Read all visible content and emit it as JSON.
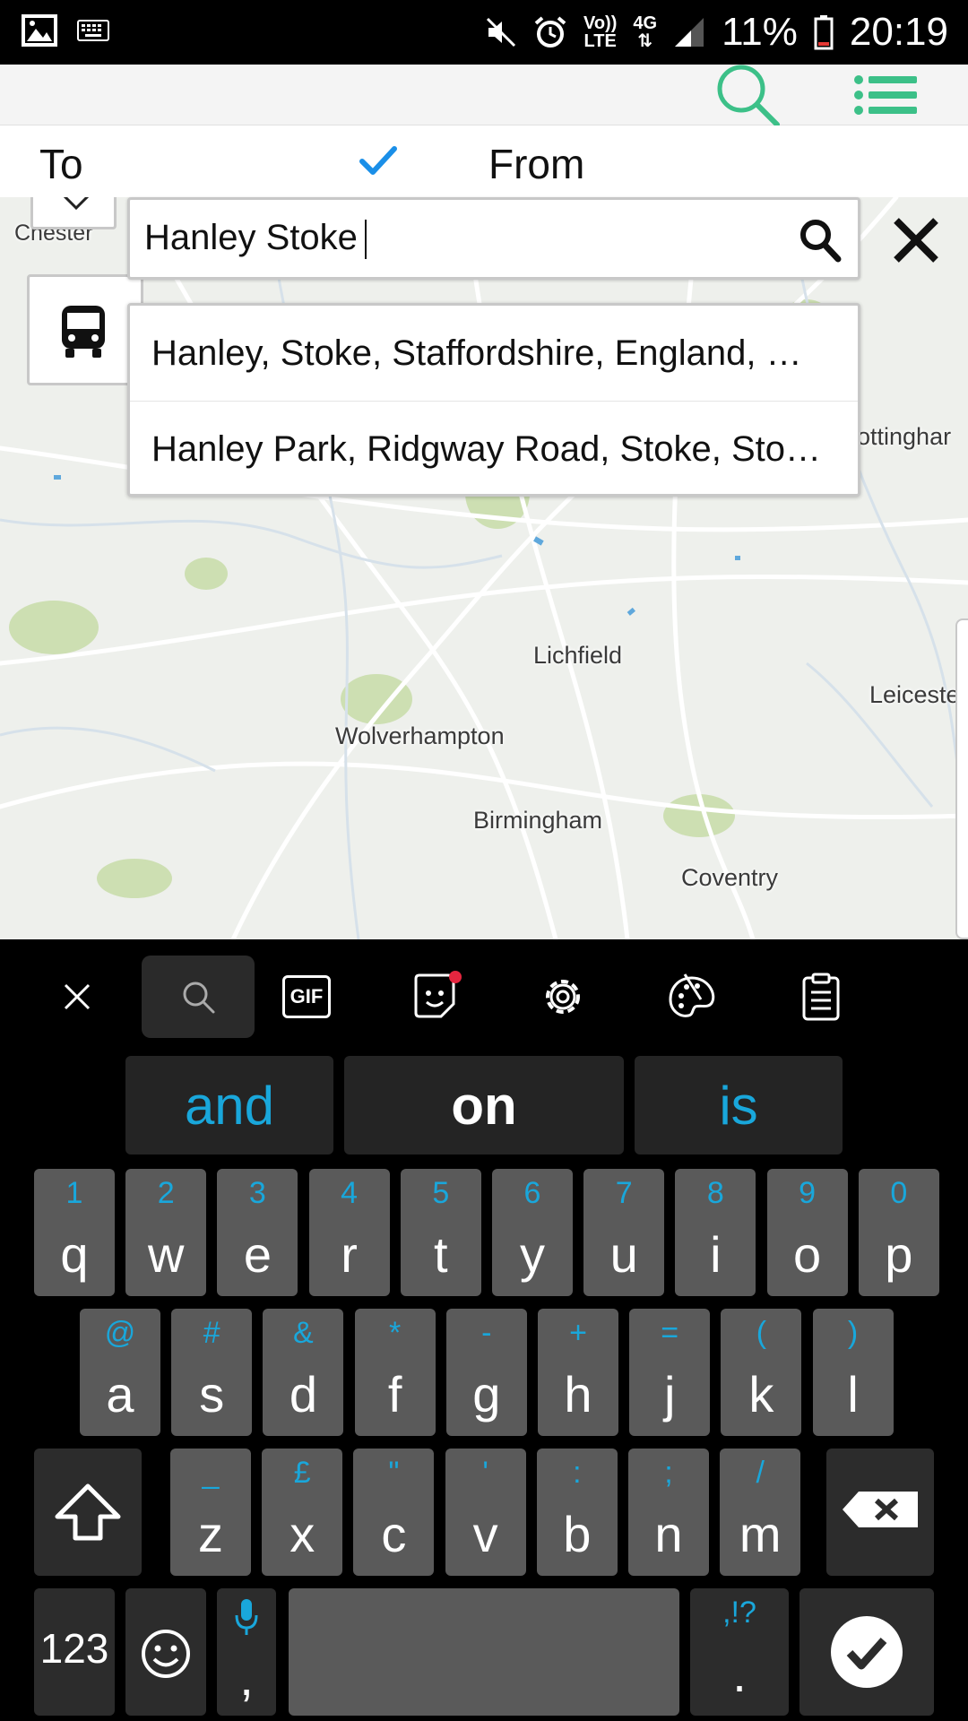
{
  "status_bar": {
    "volte_top": "Vo))",
    "volte_bottom": "LTE",
    "network": "4G",
    "battery": "11%",
    "time": "20:19"
  },
  "app_bar": {
    "icons": [
      "search-icon",
      "list-menu-icon"
    ],
    "accent": "#3cc088"
  },
  "direction": {
    "to_label": "To",
    "from_label": "From",
    "check_color": "#1a8fe8"
  },
  "search": {
    "value": "Hanley Stoke",
    "suggestions": [
      "Hanley, Stoke, Staffordshire, England, …",
      "Hanley Park, Ridgway Road, Stoke, Sto…"
    ]
  },
  "map": {
    "labels": {
      "chester": "Chester",
      "nottingham": "lottinghar",
      "lichfield": "Lichfield",
      "leicester": "Leiceste",
      "wolverhampton": "Wolverhampton",
      "birmingham": "Birmingham",
      "coventry": "Coventry"
    }
  },
  "keyboard": {
    "accent": "#19a7db",
    "toolbar": [
      "close-icon",
      "search-icon",
      "gif-icon",
      "sticker-icon",
      "settings-icon",
      "palette-icon",
      "clipboard-icon"
    ],
    "gif_label": "GIF",
    "suggestions": [
      "and",
      "on",
      "is"
    ],
    "row1": [
      {
        "main": "q",
        "hint": "1"
      },
      {
        "main": "w",
        "hint": "2"
      },
      {
        "main": "e",
        "hint": "3"
      },
      {
        "main": "r",
        "hint": "4"
      },
      {
        "main": "t",
        "hint": "5"
      },
      {
        "main": "y",
        "hint": "6"
      },
      {
        "main": "u",
        "hint": "7"
      },
      {
        "main": "i",
        "hint": "8"
      },
      {
        "main": "o",
        "hint": "9"
      },
      {
        "main": "p",
        "hint": "0"
      }
    ],
    "row2": [
      {
        "main": "a",
        "hint": "@"
      },
      {
        "main": "s",
        "hint": "#"
      },
      {
        "main": "d",
        "hint": "&"
      },
      {
        "main": "f",
        "hint": "*"
      },
      {
        "main": "g",
        "hint": "-"
      },
      {
        "main": "h",
        "hint": "+"
      },
      {
        "main": "j",
        "hint": "="
      },
      {
        "main": "k",
        "hint": "("
      },
      {
        "main": "l",
        "hint": ")"
      }
    ],
    "row3": [
      {
        "main": "z",
        "hint": "_"
      },
      {
        "main": "x",
        "hint": "£"
      },
      {
        "main": "c",
        "hint": "\""
      },
      {
        "main": "v",
        "hint": "'"
      },
      {
        "main": "b",
        "hint": ":"
      },
      {
        "main": "n",
        "hint": ";"
      },
      {
        "main": "m",
        "hint": "/"
      }
    ],
    "num_label": "123",
    "comma": ",",
    "period": ".",
    "period_hint": ",!?"
  }
}
